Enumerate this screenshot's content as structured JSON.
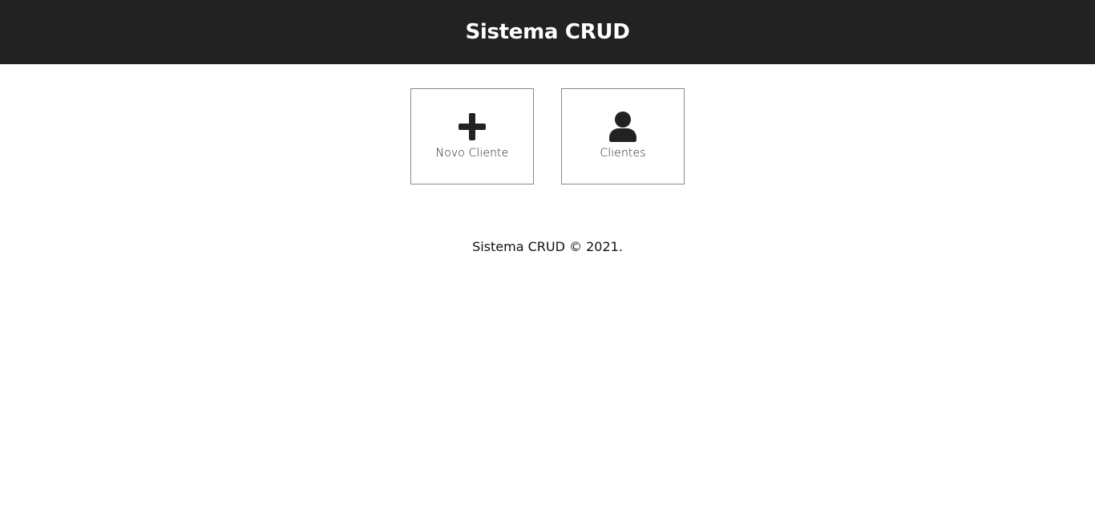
{
  "header": {
    "title": "Sistema CRUD"
  },
  "menu": {
    "items": [
      {
        "label": "Novo Cliente",
        "icon": "plus-icon"
      },
      {
        "label": "Clientes",
        "icon": "user-icon"
      }
    ]
  },
  "footer": {
    "text": "Sistema CRUD © 2021."
  },
  "colors": {
    "header_bg": "#222222",
    "header_text": "#ffffff",
    "card_border": "#888888",
    "icon": "#222222"
  }
}
